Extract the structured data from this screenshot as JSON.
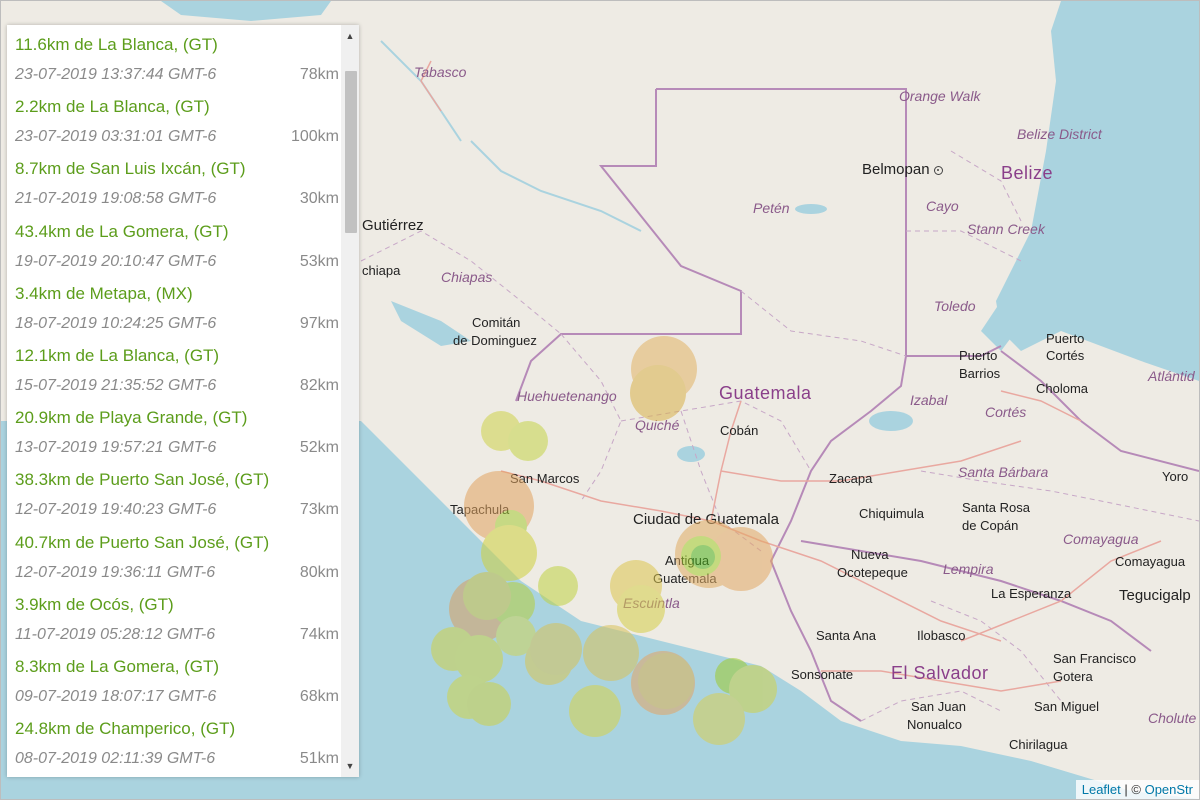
{
  "events": [
    {
      "place": "11.6km de La Blanca, (GT)",
      "time": "23-07-2019 13:37:44 GMT-6",
      "depth": "78km"
    },
    {
      "place": "2.2km de La Blanca, (GT)",
      "time": "23-07-2019 03:31:01 GMT-6",
      "depth": "100km"
    },
    {
      "place": "8.7km de San Luis Ixcán, (GT)",
      "time": "21-07-2019 19:08:58 GMT-6",
      "depth": "30km"
    },
    {
      "place": "43.4km de La Gomera, (GT)",
      "time": "19-07-2019 20:10:47 GMT-6",
      "depth": "53km"
    },
    {
      "place": "3.4km de Metapa, (MX)",
      "time": "18-07-2019 10:24:25 GMT-6",
      "depth": "97km"
    },
    {
      "place": "12.1km de La Blanca, (GT)",
      "time": "15-07-2019 21:35:52 GMT-6",
      "depth": "82km"
    },
    {
      "place": "20.9km de Playa Grande, (GT)",
      "time": "13-07-2019 19:57:21 GMT-6",
      "depth": "52km"
    },
    {
      "place": "38.3km de Puerto San José, (GT)",
      "time": "12-07-2019 19:40:23 GMT-6",
      "depth": "73km"
    },
    {
      "place": "40.7km de Puerto San José, (GT)",
      "time": "12-07-2019 19:36:11 GMT-6",
      "depth": "80km"
    },
    {
      "place": "3.9km de Ocós, (GT)",
      "time": "11-07-2019 05:28:12 GMT-6",
      "depth": "74km"
    },
    {
      "place": "8.3km de La Gomera, (GT)",
      "time": "09-07-2019 18:07:17 GMT-6",
      "depth": "68km"
    },
    {
      "place": "24.8km de Champerico, (GT)",
      "time": "08-07-2019 02:11:39 GMT-6",
      "depth": "51km"
    }
  ],
  "scroll": {
    "up_icon": "▲",
    "down_icon": "▼"
  },
  "map": {
    "labels": {
      "tabasco": "Tabasco",
      "orange_walk": "Orange Walk",
      "belize_district": "Belize District",
      "belmopan": "Belmopan",
      "belize": "Belize",
      "peten": "Petén",
      "cayo": "Cayo",
      "stann_creek": "Stann Creek",
      "gutierrez": "Gutiérrez",
      "chiapa": "chiapa",
      "chiapas": "Chiapas",
      "toledo": "Toledo",
      "comitan": "Comitán",
      "de_dominguez": "de Dominguez",
      "puerto_barrios": "Puerto",
      "puerto_barrios2": "Barrios",
      "puerto_cortes": "Puerto",
      "puerto_cortes2": "Cortés",
      "huehuetenango": "Huehuetenango",
      "guatemala": "Guatemala",
      "izabal": "Izabal",
      "choloma": "Choloma",
      "atlantida": "Atlántid",
      "cortes": "Cortés",
      "quiche": "Quiché",
      "coban": "Cobán",
      "santa_barbara": "Santa Bárbara",
      "yoro": "Yoro",
      "san_marcos": "San Marcos",
      "zacapa": "Zacapa",
      "santa_rosa": "Santa Rosa",
      "de_copan": "de Copán",
      "tapachula": "Tapachula",
      "ciudad_guatemala": "Ciudad de Guatemala",
      "chiquimula": "Chiquimula",
      "comayagua_dept": "Comayagua",
      "comayagua": "Comayagua",
      "antigua": "Antigua",
      "antigua2": "Guatemala",
      "nueva": "Nueva",
      "ocotepeque": "Ocotepeque",
      "lempira": "Lempira",
      "escuintla": "Escuintla",
      "la_esperanza": "La Esperanza",
      "tegucigalpa": "Tegucigalp",
      "santa_ana": "Santa Ana",
      "ilobasco": "Ilobasco",
      "sonsonate": "Sonsonate",
      "el_salvador": "El Salvador",
      "san_francisco": "San Francisco",
      "gotera": "Gotera",
      "san_juan": "San Juan",
      "nonualco": "Nonualco",
      "san_miguel": "San Miguel",
      "chirilagua": "Chirilagua",
      "cholute": "Cholute"
    }
  },
  "attribution": {
    "leaflet": "Leaflet",
    "sep": " | © ",
    "osm": "OpenStr"
  }
}
